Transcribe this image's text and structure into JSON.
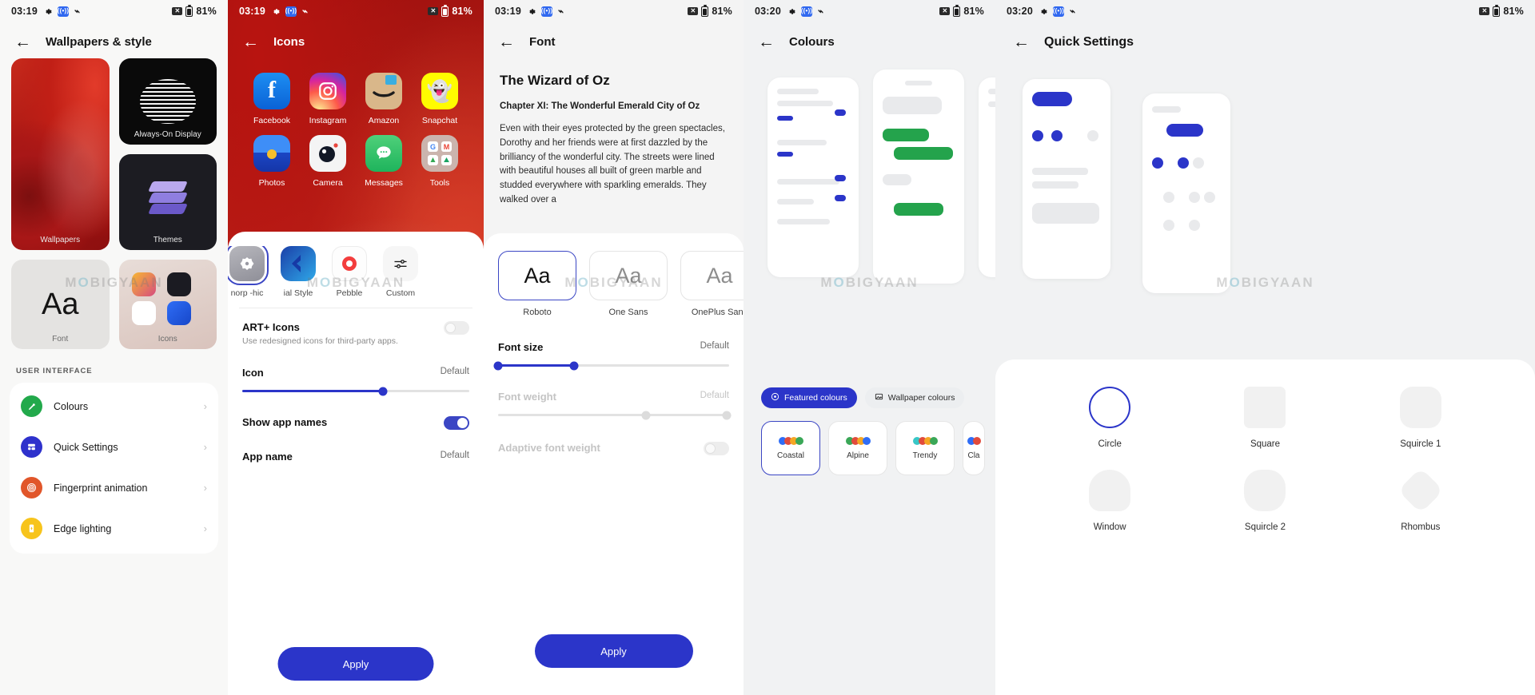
{
  "panels": [
    {
      "id": "wallpapers-style",
      "status": {
        "time": "03:19",
        "battery": "81%",
        "icons": [
          "gear-icon",
          "nfc-icon",
          "wave-icon",
          "battery-x-icon",
          "battery-icon"
        ]
      },
      "title": "Wallpapers & style",
      "tiles": [
        {
          "label": "Wallpapers",
          "name": "wallpapers-tile"
        },
        {
          "label": "Always-On Display",
          "name": "always-on-display-tile"
        },
        {
          "label": "Themes",
          "name": "themes-tile"
        },
        {
          "label": "Font",
          "name": "font-tile",
          "glyph": "Aa"
        },
        {
          "label": "Icons",
          "name": "icons-tile"
        }
      ],
      "section_header": "USER INTERFACE",
      "items": [
        {
          "label": "Colours",
          "icon": "paint-roller-icon",
          "color": "#22a94b"
        },
        {
          "label": "Quick Settings",
          "icon": "quick-settings-icon",
          "color": "#2e31cc"
        },
        {
          "label": "Fingerprint animation",
          "icon": "fingerprint-icon",
          "color": "#e1562a"
        },
        {
          "label": "Edge lighting",
          "icon": "edge-lighting-icon",
          "color": "#f7c41c"
        }
      ]
    },
    {
      "id": "icons",
      "status": {
        "time": "03:19",
        "battery": "81%"
      },
      "title": "Icons",
      "apps": [
        {
          "name": "Facebook",
          "color": "#1877f2",
          "glyph": "f"
        },
        {
          "name": "Instagram",
          "color": "#d6249f",
          "glyph": "◉"
        },
        {
          "name": "Amazon",
          "color": "#d9b78a",
          "glyph": ""
        },
        {
          "name": "Snapchat",
          "color": "#fffc00",
          "glyph": "👻"
        },
        {
          "name": "Photos",
          "color": "#2f6df6",
          "glyph": ""
        },
        {
          "name": "Camera",
          "color": "#f2f2f2",
          "glyph": ""
        },
        {
          "name": "Messages",
          "color": "#2ecc71",
          "glyph": ""
        },
        {
          "name": "Tools",
          "color": "#cbb4ad",
          "glyph": ""
        }
      ],
      "styles": [
        {
          "label": "norp -hic",
          "selected": true
        },
        {
          "label": "ial Style",
          "selected": false
        },
        {
          "label": "Pebble",
          "selected": false
        },
        {
          "label": "Custom",
          "selected": false
        }
      ],
      "art_icons": {
        "title": "ART+ Icons",
        "subtitle": "Use redesigned icons for third-party apps.",
        "toggle": "off"
      },
      "icon_size": {
        "title": "Icon",
        "value_label": "Default",
        "fill_pct": 62
      },
      "show_app_names": {
        "title": "Show app names",
        "toggle": "on"
      },
      "app_name": {
        "title": "App name",
        "value_label": "Default"
      },
      "apply_label": "Apply"
    },
    {
      "id": "font",
      "status": {
        "time": "03:19",
        "battery": "81%"
      },
      "title": "Font",
      "book_title": "The Wizard of Oz",
      "book_chapter": "Chapter XI: The Wonderful Emerald City of Oz",
      "book_body": "Even with their eyes protected by the green spectacles, Dorothy and her friends were at first dazzled by the brilliancy of the wonderful city. The streets were lined with beautiful houses all built of green marble and studded everywhere with sparkling emeralds. They walked over a",
      "fonts": [
        {
          "label": "Roboto",
          "sample": "Aa",
          "selected": true
        },
        {
          "label": "One Sans",
          "sample": "Aa",
          "selected": false
        },
        {
          "label": "OnePlus Sans",
          "sample": "Aa",
          "selected": false
        }
      ],
      "font_size": {
        "title": "Font size",
        "value_label": "Default",
        "fill_pct": 33
      },
      "font_weight": {
        "title": "Font weight",
        "value_label": "Default",
        "fill_pct": 64
      },
      "adaptive_font_weight": {
        "title": "Adaptive font weight",
        "toggle": "off"
      },
      "apply_label": "Apply"
    },
    {
      "id": "colours",
      "status": {
        "time": "03:20",
        "battery": "81%"
      },
      "title": "Colours",
      "tabs": [
        {
          "label": "Featured colours",
          "icon": "palette-icon",
          "selected": true
        },
        {
          "label": "Wallpaper colours",
          "icon": "image-icon",
          "selected": false
        }
      ],
      "palettes": [
        {
          "name": "Coastal",
          "colors": [
            "#2f6df6",
            "#e14b3c",
            "#f5a623",
            "#3aa757"
          ],
          "selected": true
        },
        {
          "name": "Alpine",
          "colors": [
            "#3aa757",
            "#e14b3c",
            "#f5a623",
            "#2f6df6"
          ],
          "selected": false
        },
        {
          "name": "Trendy",
          "colors": [
            "#38c7c7",
            "#e14b3c",
            "#f5a623",
            "#3aa757"
          ],
          "selected": false
        },
        {
          "name": "Cla",
          "colors": [
            "#2f6df6",
            "#e14b3c"
          ],
          "selected": false
        }
      ]
    },
    {
      "id": "quick-settings",
      "status": {
        "time": "03:20",
        "battery": "81%"
      },
      "title": "Quick Settings",
      "shapes": [
        {
          "label": "Circle",
          "shape": "circle",
          "selected": true
        },
        {
          "label": "Square",
          "shape": "square",
          "selected": false
        },
        {
          "label": "Squircle 1",
          "shape": "squircle1",
          "selected": false
        },
        {
          "label": "Window",
          "shape": "window",
          "selected": false
        },
        {
          "label": "Squircle 2",
          "shape": "squircle2",
          "selected": false
        },
        {
          "label": "Rhombus",
          "shape": "rhombus",
          "selected": false
        }
      ]
    }
  ],
  "watermark": {
    "pre": "M",
    "o": "O",
    "post": "BIGYAAN"
  },
  "colors": {
    "accent": "#2b35c9",
    "selected_border": "#3b46c4"
  }
}
